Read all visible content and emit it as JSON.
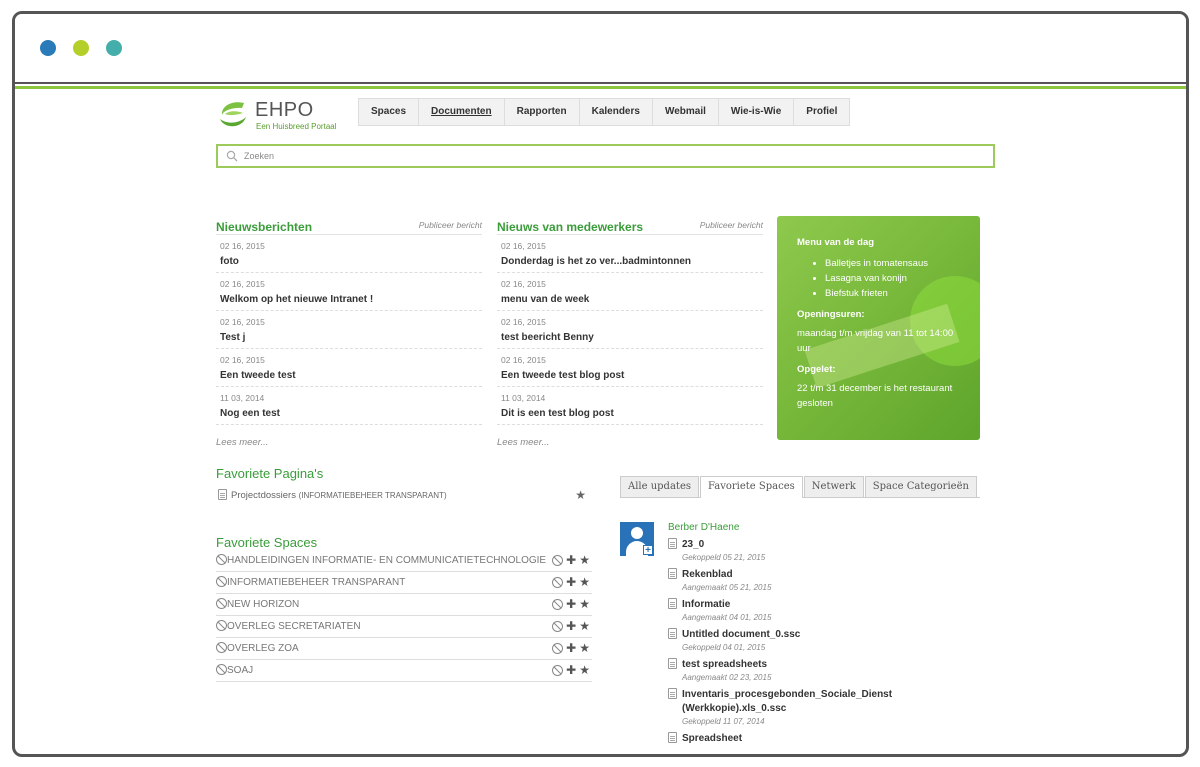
{
  "window": {
    "dot_colors": [
      "#2b7bb9",
      "#b5cf2a",
      "#43aeaa"
    ],
    "accent_color": "#8cc63f"
  },
  "logo": {
    "name": "EHPO",
    "tagline": "Een Huisbreed Portaal"
  },
  "nav": {
    "items": [
      {
        "label": "Spaces"
      },
      {
        "label": "Documenten"
      },
      {
        "label": "Rapporten"
      },
      {
        "label": "Kalenders"
      },
      {
        "label": "Webmail"
      },
      {
        "label": "Wie-is-Wie"
      },
      {
        "label": "Profiel"
      }
    ],
    "active": "Documenten"
  },
  "search": {
    "placeholder": "Zoeken"
  },
  "news": {
    "title": "Nieuwsberichten",
    "action": "Publiceer bericht",
    "items": [
      {
        "date": "02 16, 2015",
        "title": "foto"
      },
      {
        "date": "02 16, 2015",
        "title": "Welkom op het nieuwe Intranet !"
      },
      {
        "date": "02 16, 2015",
        "title": "Test j"
      },
      {
        "date": "02 16, 2015",
        "title": "Een tweede test"
      },
      {
        "date": "11 03, 2014",
        "title": "Nog een test"
      }
    ],
    "read_more": "Lees meer..."
  },
  "employee_news": {
    "title": "Nieuws van medewerkers",
    "action": "Publiceer bericht",
    "items": [
      {
        "date": "02 16, 2015",
        "title": "Donderdag is het zo ver...badmintonnen"
      },
      {
        "date": "02 16, 2015",
        "title": "menu van de week"
      },
      {
        "date": "02 16, 2015",
        "title": "test beericht Benny"
      },
      {
        "date": "02 16, 2015",
        "title": "Een tweede test blog post"
      },
      {
        "date": "11 03, 2014",
        "title": "Dit is een test blog post"
      }
    ],
    "read_more": "Lees meer..."
  },
  "menu_card": {
    "heading": "Menu van de dag",
    "dishes": [
      "Balletjes in tomatensaus",
      "Lasagna van konijn",
      "Biefstuk frieten"
    ],
    "hours_heading": "Openingsuren:",
    "hours_text": "maandag t/m vrijdag van 11 tot 14:00 uur",
    "notice_heading": "Opgelet:",
    "notice_text": "22 t/m 31 december is het restaurant gesloten"
  },
  "favorite_pages": {
    "title": "Favoriete Pagina's",
    "items": [
      {
        "name": "Projectdossiers",
        "space": "(INFORMATIEBEHEER TRANSPARANT)"
      }
    ]
  },
  "favorite_spaces": {
    "title": "Favoriete Spaces",
    "items": [
      {
        "name": "HANDLEIDINGEN INFORMATIE- EN COMMUNICATIETECHNOLOGIE"
      },
      {
        "name": "INFORMATIEBEHEER TRANSPARANT"
      },
      {
        "name": "NEW HORIZON"
      },
      {
        "name": "OVERLEG SECRETARIATEN"
      },
      {
        "name": "OVERLEG ZOA"
      },
      {
        "name": "SOAJ"
      }
    ]
  },
  "updates": {
    "tabs": [
      {
        "label": "Alle updates"
      },
      {
        "label": "Favoriete Spaces"
      },
      {
        "label": "Netwerk"
      },
      {
        "label": "Space Categorieën"
      }
    ],
    "active_tab": "Favoriete Spaces",
    "user": "Berber D'Haene",
    "items": [
      {
        "title": "23_0",
        "meta": "Gekoppeld 05 21, 2015"
      },
      {
        "title": "Rekenblad",
        "meta": "Aangemaakt 05 21, 2015"
      },
      {
        "title": "Informatie",
        "meta": "Aangemaakt 04 01, 2015"
      },
      {
        "title": "Untitled document_0.ssc",
        "meta": "Gekoppeld 04 01, 2015"
      },
      {
        "title": "test spreadsheets",
        "meta": "Aangemaakt 02 23, 2015"
      },
      {
        "title": "Inventaris_procesgebonden_Sociale_Dienst (Werkkopie).xls_0.ssc",
        "meta": "Gekoppeld 11 07, 2014"
      },
      {
        "title": "Spreadsheet",
        "meta": ""
      }
    ]
  }
}
